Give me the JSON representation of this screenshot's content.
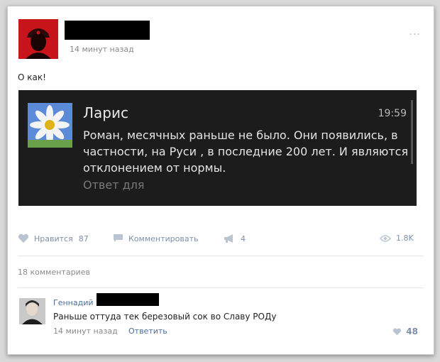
{
  "post": {
    "time": "14 минут назад",
    "more": "...",
    "text": "О как!"
  },
  "embed": {
    "sender": "Ларис",
    "time": "19:59",
    "message": "Роман, месячных раньше не было. Они появились, в частности, на Руси , в последние 200 лет. И являются отклонением от нормы.",
    "reply_placeholder": "Ответ для"
  },
  "actions": {
    "like_label": "Нравится",
    "like_count": "87",
    "comment_label": "Комментировать",
    "share_count": "4",
    "views": "1.8K"
  },
  "comments": {
    "count_label": "18 комментариев",
    "items": [
      {
        "name": "Геннадий",
        "text": "Раньше оттуда тек березовый сок во Славу РОДу",
        "time": "14 минут назад",
        "reply_label": "Ответить",
        "likes": "48"
      }
    ]
  },
  "colors": {
    "accent": "#4a6e9a",
    "avatar_red": "#c8141b",
    "embed_bg": "#1c1c1c"
  }
}
